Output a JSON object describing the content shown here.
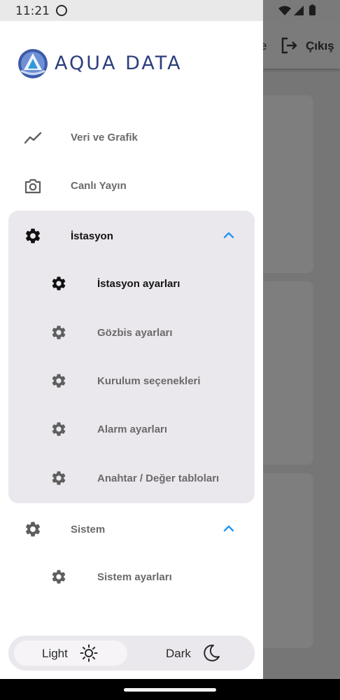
{
  "status_bar": {
    "time": "11:21"
  },
  "background_app": {
    "exit_label": "Çıkış",
    "cut_letter": "e"
  },
  "logo": {
    "text": "AQUA DATA"
  },
  "nav": [
    {
      "label": "Veri ve Grafik",
      "icon": "chart-line-icon"
    },
    {
      "label": "Canlı Yayın",
      "icon": "camera-icon"
    }
  ],
  "groups": {
    "istasyon": {
      "label": "İstasyon",
      "expanded": true,
      "items": [
        {
          "label": "İstasyon ayarları",
          "active": true
        },
        {
          "label": "Gözbis ayarları"
        },
        {
          "label": "Kurulum seçenekleri"
        },
        {
          "label": "Alarm ayarları"
        },
        {
          "label": "Anahtar / Değer tabloları"
        }
      ]
    },
    "sistem": {
      "label": "Sistem",
      "expanded": true,
      "items": [
        {
          "label": "Sistem ayarları"
        }
      ]
    }
  },
  "theme": {
    "light_label": "Light",
    "dark_label": "Dark",
    "selected": "Light"
  },
  "colors": {
    "accent": "#2196f3",
    "group_bg": "#ebe8ed",
    "logo_blue": "#2d3f7c",
    "scrim": "#767676"
  }
}
